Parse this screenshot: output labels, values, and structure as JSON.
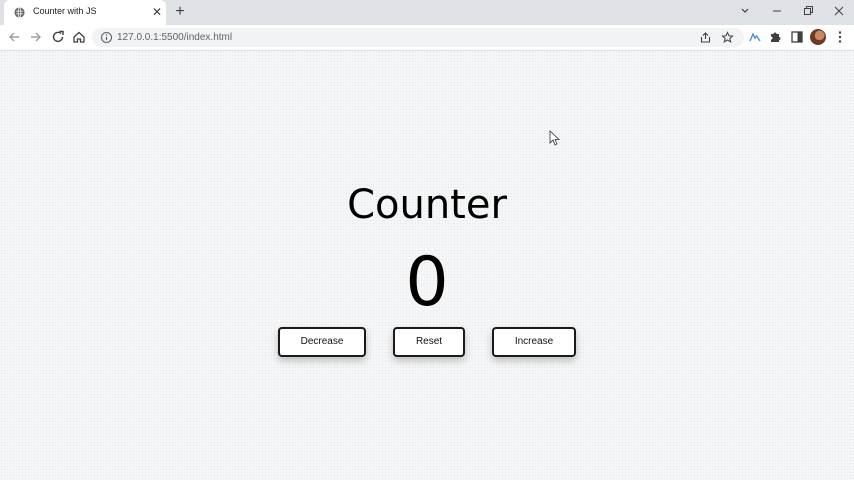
{
  "browser": {
    "tab_title": "Counter with JS",
    "url": "127.0.0.1:5500/index.html",
    "icons": {
      "favicon": "globe-icon",
      "tab_close": "close-icon",
      "new_tab": "plus-icon",
      "back": "back-arrow-icon",
      "forward": "forward-arrow-icon",
      "reload": "reload-icon",
      "home": "home-icon",
      "site_info": "info-icon",
      "share": "share-icon",
      "bookmark": "star-icon",
      "extension": "extension-icon",
      "extensions": "puzzle-icon",
      "side_panel": "side-panel-icon",
      "menu": "kebab-menu-icon"
    }
  },
  "page": {
    "heading": "Counter",
    "count": "0",
    "buttons": {
      "decrease": "Decrease",
      "reset": "Reset",
      "increase": "Increase"
    }
  },
  "colors": {
    "page_background": "#f4f6f7",
    "text": "#000000",
    "button_border": "#1a1a1a"
  }
}
